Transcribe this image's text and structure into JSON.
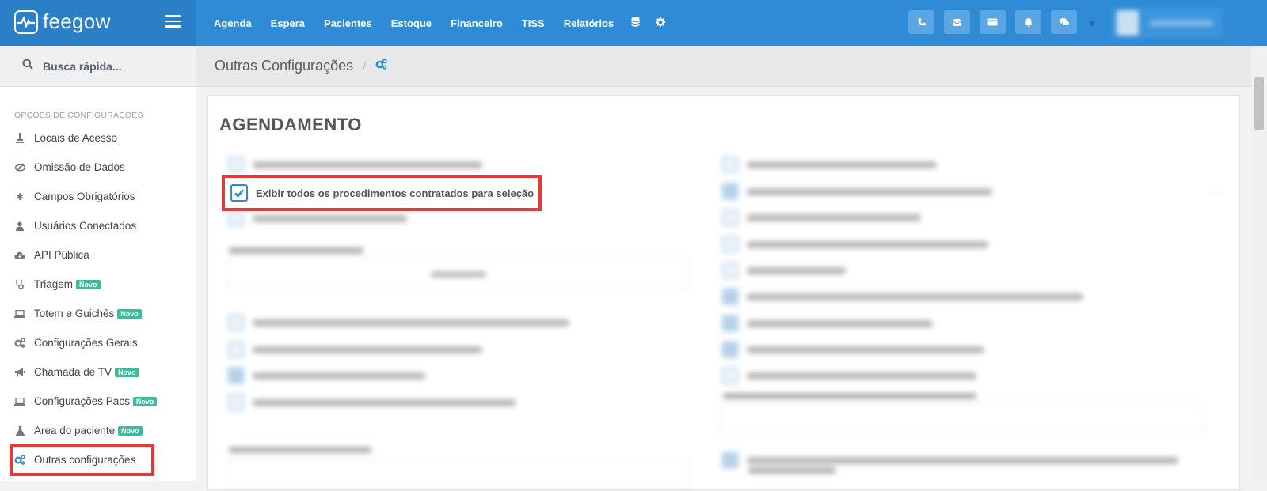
{
  "app": {
    "logo_text": "feegow",
    "brand_color": "#2f8bd6"
  },
  "topnav": {
    "items": [
      "Agenda",
      "Espera",
      "Pacientes",
      "Estoque",
      "Financeiro",
      "TISS",
      "Relatórios"
    ],
    "icons": [
      "database-icon",
      "gear-icon"
    ],
    "actions": [
      "phone-icon",
      "inbox-icon",
      "card-icon",
      "bell-icon",
      "chat-icon"
    ]
  },
  "sidebar": {
    "search_placeholder": "Busca rápida...",
    "header": "OPÇÕES DE CONFIGURAÇÕES",
    "items": [
      {
        "label": "Locais de Acesso",
        "icon": "pin-icon"
      },
      {
        "label": "Omissão de Dados",
        "icon": "eye-slash-icon"
      },
      {
        "label": "Campos Obrigatórios",
        "icon": "asterisk-icon"
      },
      {
        "label": "Usuários Conectados",
        "icon": "user-icon"
      },
      {
        "label": "API Pública",
        "icon": "cloud-icon"
      },
      {
        "label": "Triagem",
        "icon": "stethoscope-icon",
        "badge": "Novo"
      },
      {
        "label": "Totem e Guichês",
        "icon": "laptop-icon",
        "badge": "Novo"
      },
      {
        "label": "Configurações Gerais",
        "icon": "gears-icon"
      },
      {
        "label": "Chamada de TV",
        "icon": "megaphone-icon",
        "badge": "Novo"
      },
      {
        "label": "Configurações Pacs",
        "icon": "laptop-icon",
        "badge": "Novo"
      },
      {
        "label": "Área do paciente",
        "icon": "flask-icon",
        "badge": "Novo"
      },
      {
        "label": "Outras configurações",
        "icon": "gears-icon",
        "active": true
      }
    ]
  },
  "breadcrumb": {
    "title": "Outras Configurações",
    "sep": "/"
  },
  "content": {
    "section_title": "AGENDAMENTO",
    "focused_option": {
      "label": "Exibir todos os procedimentos contratados para seleção",
      "checked": true
    },
    "highlight_color": "#e53935"
  }
}
